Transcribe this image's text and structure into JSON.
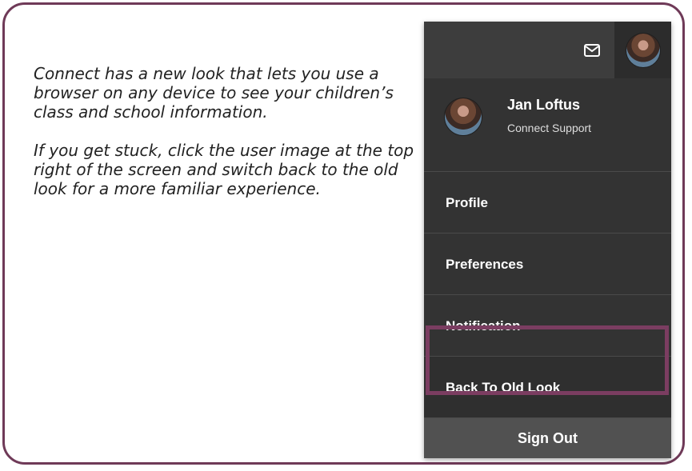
{
  "help_text": {
    "paragraph_1": "Connect has a new look that lets you use a browser on any device to see your children’s class and school information.",
    "paragraph_2": "If you get stuck, click the user image at the top right of the screen and switch back to the old look for a more familiar experience."
  },
  "menu": {
    "user": {
      "name": "Jan Loftus",
      "organization": "Connect Support"
    },
    "items": [
      {
        "label": "Profile"
      },
      {
        "label": "Preferences"
      },
      {
        "label": "Notification"
      },
      {
        "label": "Back To Old Look"
      }
    ],
    "sign_out": "Sign Out"
  },
  "icons": {
    "mail": "mail-icon",
    "avatar": "user-avatar"
  },
  "colors": {
    "frame_border": "#6f3a58",
    "highlight": "#7b3d61",
    "menu_bg": "#333333",
    "topbar_bg": "#3d3d3d",
    "signout_bg": "#515151"
  }
}
